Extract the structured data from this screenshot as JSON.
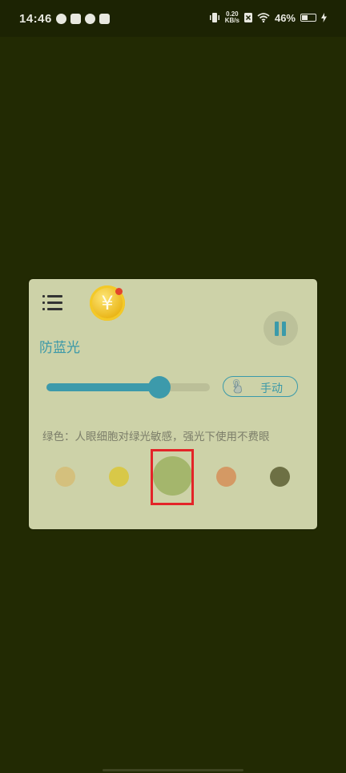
{
  "status_bar": {
    "time": "14:46",
    "net_speed_value": "0.20",
    "net_speed_unit": "KB/s",
    "battery_percent": "46%",
    "battery_level": 0.46,
    "left_icons": [
      "notification-icon",
      "message-icon",
      "link-icon",
      "mail-icon"
    ],
    "right_icons": [
      "vibrate-icon",
      "no-sim-icon",
      "wifi-icon",
      "battery-icon",
      "charging-icon"
    ]
  },
  "app": {
    "title": "防蓝光",
    "coin_symbol": "¥",
    "manual_label": "手动",
    "description": "绿色：人眼细胞对绿光敏感，强光下使用不费眼",
    "slider_value": 0.69,
    "colors": {
      "accent": "#3c9aab",
      "card_background": "#cdd2a8",
      "screen_filter": "#222a03",
      "highlight": "#e32428"
    },
    "swatches": [
      {
        "name": "beige",
        "color": "#d4c07d",
        "selected": false
      },
      {
        "name": "yellow",
        "color": "#d8c848",
        "selected": false
      },
      {
        "name": "green",
        "color": "#a4b66c",
        "selected": true
      },
      {
        "name": "orange",
        "color": "#d49964",
        "selected": false
      },
      {
        "name": "dark-olive",
        "color": "#6d7044",
        "selected": false
      }
    ]
  }
}
